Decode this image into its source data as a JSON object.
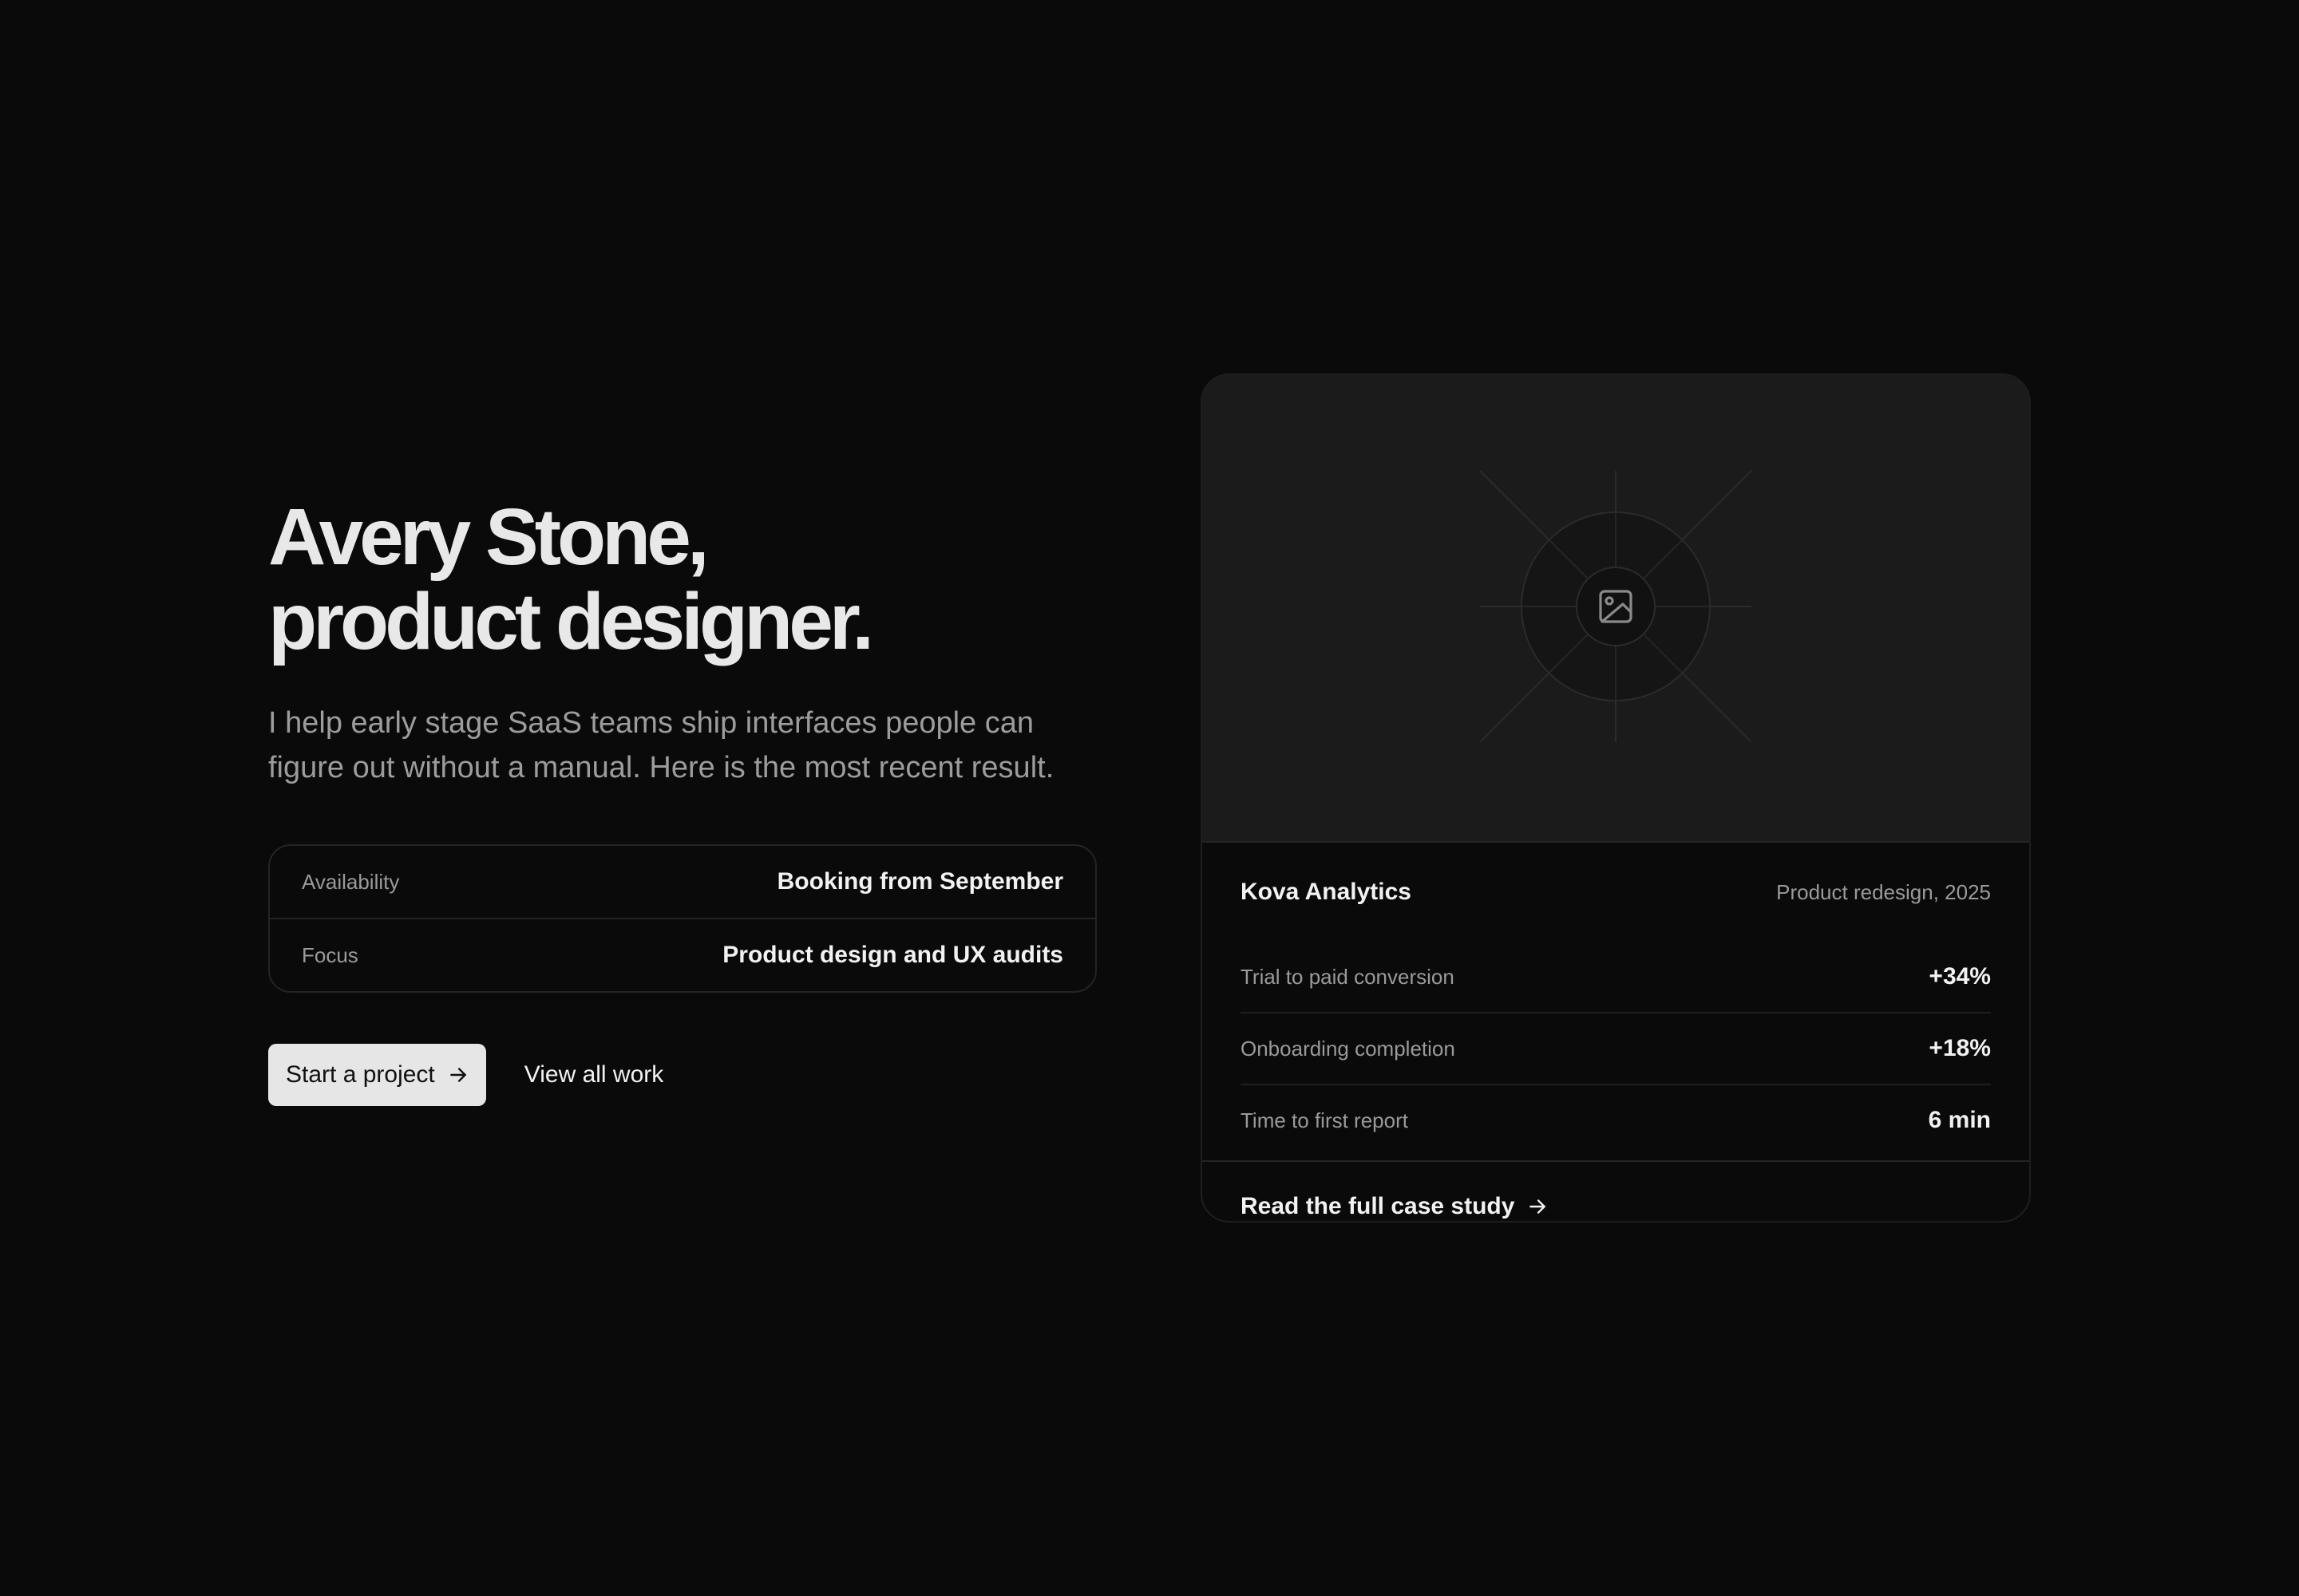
{
  "hero": {
    "title_line1": "Avery Stone,",
    "title_line2": "product designer.",
    "intro": "I help early stage SaaS teams ship interfaces people can figure out without a manual. Here is the most recent result."
  },
  "facts": [
    {
      "label": "Availability",
      "value": "Booking from September"
    },
    {
      "label": "Focus",
      "value": "Product design and UX audits"
    }
  ],
  "actions": {
    "primary_label": "Start a project",
    "primary_icon": "arrow-right-icon",
    "secondary_label": "View all work"
  },
  "case_card": {
    "image_icon": "image-placeholder-icon",
    "client": "Kova Analytics",
    "project_meta": "Product redesign, 2025",
    "metrics": [
      {
        "label": "Trial to paid conversion",
        "value": "+34%"
      },
      {
        "label": "Onboarding completion",
        "value": "+18%"
      },
      {
        "label": "Time to first report",
        "value": "6 min"
      }
    ],
    "link_label": "Read the full case study",
    "link_icon": "arrow-right-icon"
  },
  "colors": {
    "background": "#0a0a0a",
    "card_media": "#1b1b1b",
    "text_primary": "#f2f2f2",
    "text_muted": "#9a9a9a",
    "button_bg": "#e6e6e6"
  }
}
